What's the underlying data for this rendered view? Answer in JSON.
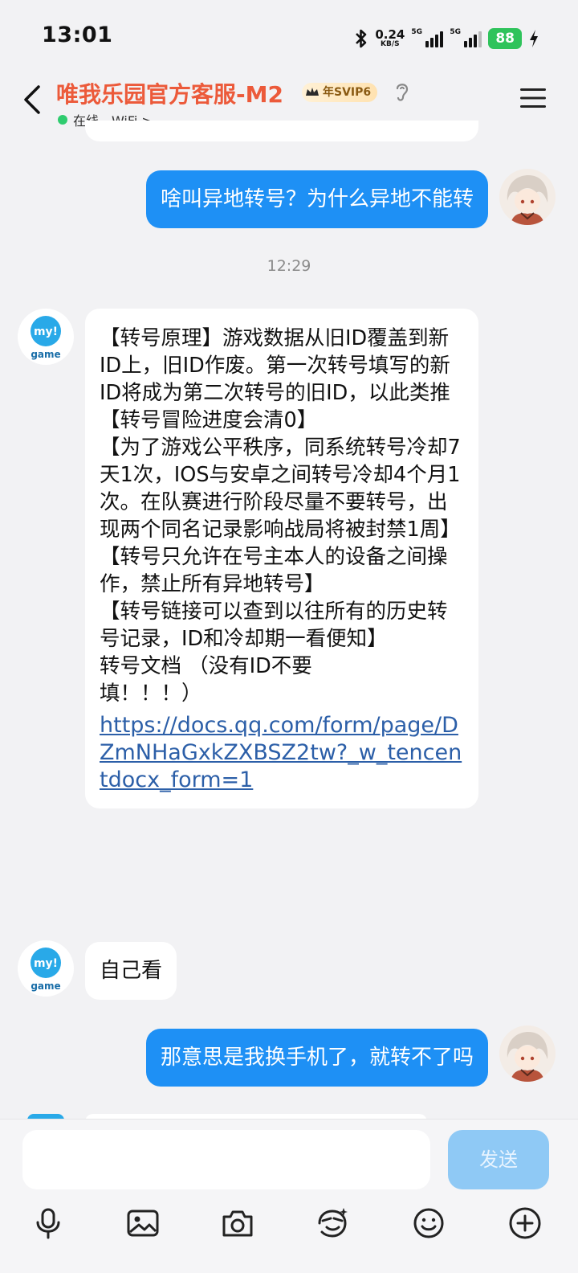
{
  "status_bar": {
    "time": "13:01",
    "net_speed_value": "0.24",
    "net_speed_unit": "KB/S",
    "sim1_label": "5G",
    "sim2_label": "5G",
    "battery": "88",
    "icons": [
      "bluetooth-icon",
      "signal-icon",
      "charging-icon"
    ]
  },
  "header": {
    "title": "唯我乐园官方客服-M2",
    "vip_badge": "年SVIP6",
    "status_text": "在线 - WiFi >",
    "status_color": "#2fcc6f",
    "title_color": "#ec5a3a"
  },
  "messages": [
    {
      "side": "out",
      "text": "啥叫异地转号？为什么异地不能转"
    },
    {
      "side": "time",
      "text": "12:29"
    },
    {
      "side": "in",
      "lines": [
        "【转号原理】游戏数据从旧ID覆盖到新ID上，旧ID作废。第一次转号填写的新ID将成为第二次转号的旧ID，以此类推",
        "【转号冒险进度会清0】",
        "【为了游戏公平秩序，同系统转号冷却7天1次，IOS与安卓之间转号冷却4个月1次。在队赛进行阶段尽量不要转号，出现两个同名记录影响战局将被封禁1周】",
        "【转号只允许在号主本人的设备之间操作，禁止所有异地转号】",
        "【转号链接可以查到以往所有的历史转号记录，ID和冷却期一看便知】",
        "转号文档 （没有ID不要填！！！）"
      ],
      "link": "https://docs.qq.com/form/page/DZmNHaGxkZXBSZ2tw?_w_tencentdocx_form=1"
    },
    {
      "side": "in",
      "text": "自己看"
    },
    {
      "side": "out",
      "text": "那意思是我换手机了，就转不了吗"
    }
  ],
  "avatar_labels": {
    "agent_top": "my!",
    "agent_bottom": "game"
  },
  "input": {
    "placeholder": "",
    "send_label": "发送"
  },
  "toolbar": [
    "mic-icon",
    "image-icon",
    "camera-icon",
    "sticker-icon",
    "emoji-icon",
    "plus-icon"
  ],
  "colors": {
    "outgoing_bubble": "#1e90f5",
    "link": "#2c5fa8",
    "send_disabled": "#8fc9f5"
  }
}
